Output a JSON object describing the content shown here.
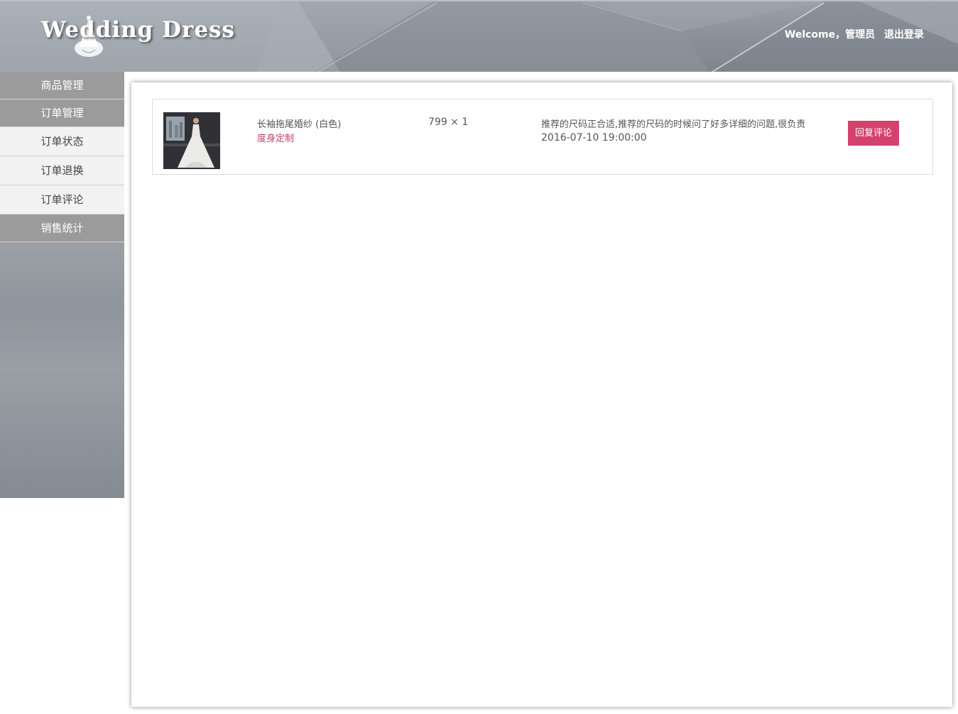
{
  "header": {
    "logo_text": "Wedding Dress",
    "welcome_text": "Welcome，管理员",
    "logout_label": "退出登录"
  },
  "sidebar": {
    "items": [
      {
        "label": "商品管理",
        "kind": "main"
      },
      {
        "label": "订单管理",
        "kind": "main"
      },
      {
        "label": "订单状态",
        "kind": "sub"
      },
      {
        "label": "订单退换",
        "kind": "sub"
      },
      {
        "label": "订单评论",
        "kind": "sub"
      },
      {
        "label": "销售统计",
        "kind": "main"
      }
    ]
  },
  "comments": [
    {
      "product_name": "长袖拖尾婚纱 (白色)",
      "product_type": "度身定制",
      "price_qty": "799 × 1",
      "comment_text": "推荐的尺码正合适,推荐的尺码的时候问了好多详细的问题,很负责",
      "comment_time": "2016-07-10 19:00:00",
      "reply_label": "回复评论",
      "thumbnail_icon": "wedding-dress-photo"
    }
  ],
  "colors": {
    "accent": "#d4416f",
    "product_type_text": "#c0406b",
    "sidebar_main_bg": "#9b9b9b",
    "sidebar_sub_bg": "#f2f2f2"
  }
}
